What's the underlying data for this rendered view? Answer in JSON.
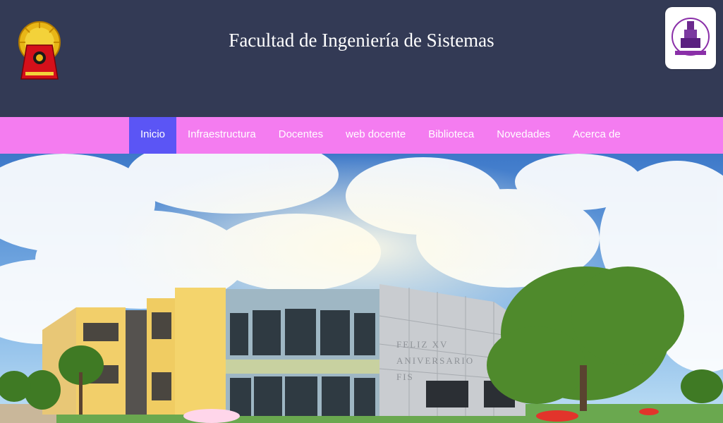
{
  "header": {
    "title": "Facultad de Ingeniería de Sistemas",
    "background": "#333a55",
    "left_logo": "university-seal-icon",
    "right_logo": "faculty-logo-icon"
  },
  "nav": {
    "background": "#f47cf0",
    "active_background": "#5b55f5",
    "items": [
      {
        "label": "Inicio",
        "active": true
      },
      {
        "label": "Infraestructura",
        "active": false
      },
      {
        "label": "Docentes",
        "active": false
      },
      {
        "label": "web docente",
        "active": false
      },
      {
        "label": "Biblioteca",
        "active": false
      },
      {
        "label": "Novedades",
        "active": false
      },
      {
        "label": "Acerca de",
        "active": false
      }
    ]
  },
  "hero": {
    "image": "building-photo",
    "building_sign": "FELIZ XV ANIVERSARIO FIS"
  }
}
